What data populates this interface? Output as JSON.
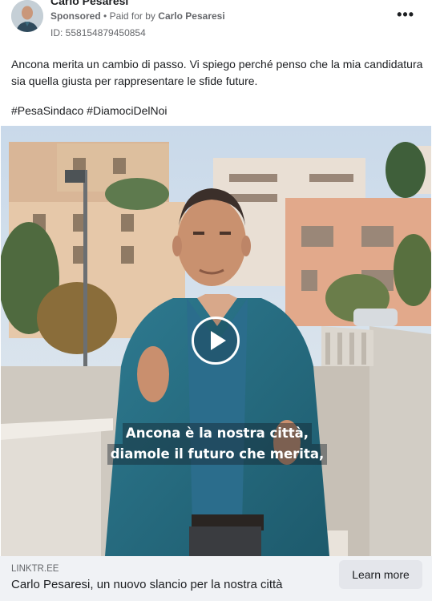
{
  "post": {
    "page_name": "Carlo Pesaresi",
    "sponsored_label": "Sponsored",
    "paid_for_label": "Paid for by",
    "payer_name": "Carlo Pesaresi",
    "ad_id": "ID: 558154879450854",
    "more_icon": "more-dots-icon",
    "body_text": "Ancona merita un cambio di passo. Vi spiego perché penso che la mia candidatura sia quella giusta per rappresentare le sfide future.",
    "hashtags": "#PesaSindaco #DiamociDelNoi"
  },
  "video": {
    "caption_line1": "Ancona è la nostra città,",
    "caption_line2": "diamole il futuro che merita,",
    "play_icon": "play-icon"
  },
  "link": {
    "domain": "LINKTR.EE",
    "title": "Carlo Pesaresi, un nuovo slancio per la nostra città",
    "cta_label": "Learn more"
  },
  "colors": {
    "text_primary": "#1c1e21",
    "text_secondary": "#65676b",
    "link_bar_bg": "#f0f2f5",
    "button_bg": "#e4e6eb"
  }
}
